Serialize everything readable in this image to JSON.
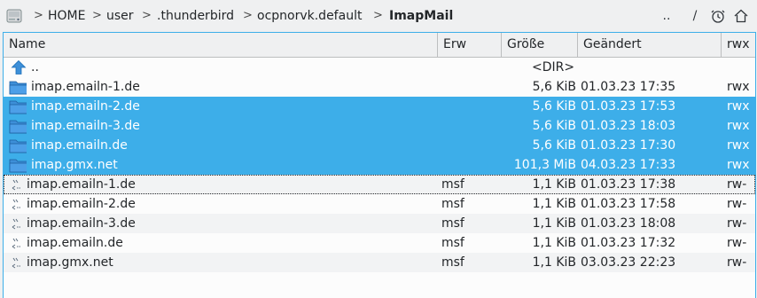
{
  "breadcrumb": {
    "drive_icon": "harddisk-icon",
    "segments": [
      "HOME",
      "user",
      ".thunderbird",
      "ocpnorvk.default",
      "ImapMail"
    ],
    "separator": ">"
  },
  "toolbar": {
    "parent_label": "..",
    "root_label": "/",
    "history_icon": "history-icon",
    "home_icon": "home-icon"
  },
  "columns": {
    "name": "Name",
    "ext": "Erw",
    "size": "Größe",
    "modified": "Geändert",
    "perm": "rwx"
  },
  "parent_row": {
    "icon": "up-arrow-icon",
    "name": "..",
    "size": "<DIR>"
  },
  "rows": [
    {
      "icon": "folder-icon",
      "name": "imap.emailn-1.de",
      "ext": "",
      "size": "5,6 KiB",
      "date": "01.03.23 17:35",
      "perm": "rwx",
      "selected": false
    },
    {
      "icon": "folder-icon",
      "name": "imap.emailn-2.de",
      "ext": "",
      "size": "5,6 KiB",
      "date": "01.03.23 17:53",
      "perm": "rwx",
      "selected": true
    },
    {
      "icon": "folder-icon",
      "name": "imap.emailn-3.de",
      "ext": "",
      "size": "5,6 KiB",
      "date": "01.03.23 18:03",
      "perm": "rwx",
      "selected": true
    },
    {
      "icon": "folder-icon",
      "name": "imap.emailn.de",
      "ext": "",
      "size": "5,6 KiB",
      "date": "01.03.23 17:30",
      "perm": "rwx",
      "selected": true
    },
    {
      "icon": "folder-icon",
      "name": "imap.gmx.net",
      "ext": "",
      "size": "101,3 MiB",
      "date": "04.03.23 17:33",
      "perm": "rwx",
      "selected": true
    },
    {
      "icon": "text-file-icon",
      "name": "imap.emailn-1.de",
      "ext": "msf",
      "size": "1,1 KiB",
      "date": "01.03.23 17:38",
      "perm": "rw-",
      "selected": false
    },
    {
      "icon": "text-file-icon",
      "name": "imap.emailn-2.de",
      "ext": "msf",
      "size": "1,1 KiB",
      "date": "01.03.23 17:58",
      "perm": "rw-",
      "selected": false
    },
    {
      "icon": "text-file-icon",
      "name": "imap.emailn-3.de",
      "ext": "msf",
      "size": "1,1 KiB",
      "date": "01.03.23 18:08",
      "perm": "rw-",
      "selected": false
    },
    {
      "icon": "text-file-icon",
      "name": "imap.emailn.de",
      "ext": "msf",
      "size": "1,1 KiB",
      "date": "01.03.23 17:32",
      "perm": "rw-",
      "selected": false
    },
    {
      "icon": "text-file-icon",
      "name": "imap.gmx.net",
      "ext": "msf",
      "size": "1,1 KiB",
      "date": "03.03.23 22:23",
      "perm": "rw-",
      "selected": false
    }
  ],
  "colors": {
    "selection": "#3daee9",
    "folder": "#3d8fd8",
    "background": "#eff0f1"
  }
}
